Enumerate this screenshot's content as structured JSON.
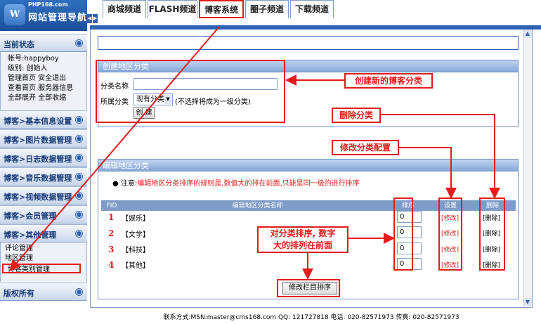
{
  "logo": {
    "domain": "PHP168.com",
    "title": "网站管理导航",
    "mark": "W"
  },
  "sidebar": {
    "status": {
      "title": "当前状态",
      "account": "帐号:happyboy",
      "level": "级别: 创始人",
      "row3": "管理首页 安全退出",
      "row4": "查看首页 服务器信息",
      "row5": "全部展开 全部收缩"
    },
    "sections": [
      "博客>基本信息设置",
      "博客>图片数据管理",
      "博客>日志数据管理",
      "博客>音乐数据管理",
      "博客>视频数据管理",
      "博客>会员管理",
      "博客>其他管理"
    ],
    "other_items": [
      "评论管理",
      "地区管理",
      "博客类别管理"
    ],
    "copyright": "版权所有"
  },
  "tabs": [
    "商城频道",
    "FLASH频道",
    "博客系统",
    "圈子频道",
    "下载频道"
  ],
  "create_panel": {
    "header": "创建地区分类",
    "name_label": "分类名称",
    "name_value": "",
    "parent_label": "所属分类",
    "parent_selected": "现有分类",
    "parent_hint": "(不选择将成为一级分类)",
    "create_button": "创 建"
  },
  "edit_panel": {
    "header": "编辑地区分类",
    "note_prefix": "注意:",
    "note": "编辑地区分类排序的规则是,数值大的排在前面,只能是同一级的进行排序",
    "columns": {
      "fid": "FID",
      "name": "编辑地区分类名称",
      "order": "排序",
      "settings": "设置",
      "delete": "删除"
    },
    "rows": [
      {
        "num": "1",
        "name": "【娱乐】",
        "order": "0",
        "edit": "[修改]",
        "del": "[删除]"
      },
      {
        "num": "2",
        "name": "【文学】",
        "order": "0",
        "edit": "[修改]",
        "del": "[删除]"
      },
      {
        "num": "3",
        "name": "【科技】",
        "order": "0",
        "edit": "[修改]",
        "del": "[删除]"
      },
      {
        "num": "4",
        "name": "【其他】",
        "order": "0",
        "edit": "[修改]",
        "del": "[删除]"
      }
    ],
    "submit_button": "修改栏目排序"
  },
  "annotations": {
    "create": "创建新的博客分类",
    "delete": "删除分类",
    "modify": "修改分类配置",
    "sort_line1": "对分类排序, 数字",
    "sort_line2": "大的排列在前面"
  },
  "footer": "联系方式:MSN:master@cms168.com QQ: 121727818 电话: 020-82571973 传真: 020-82571973",
  "colors": {
    "accent": "#2d62b5",
    "annotation": "#e41b1b"
  }
}
